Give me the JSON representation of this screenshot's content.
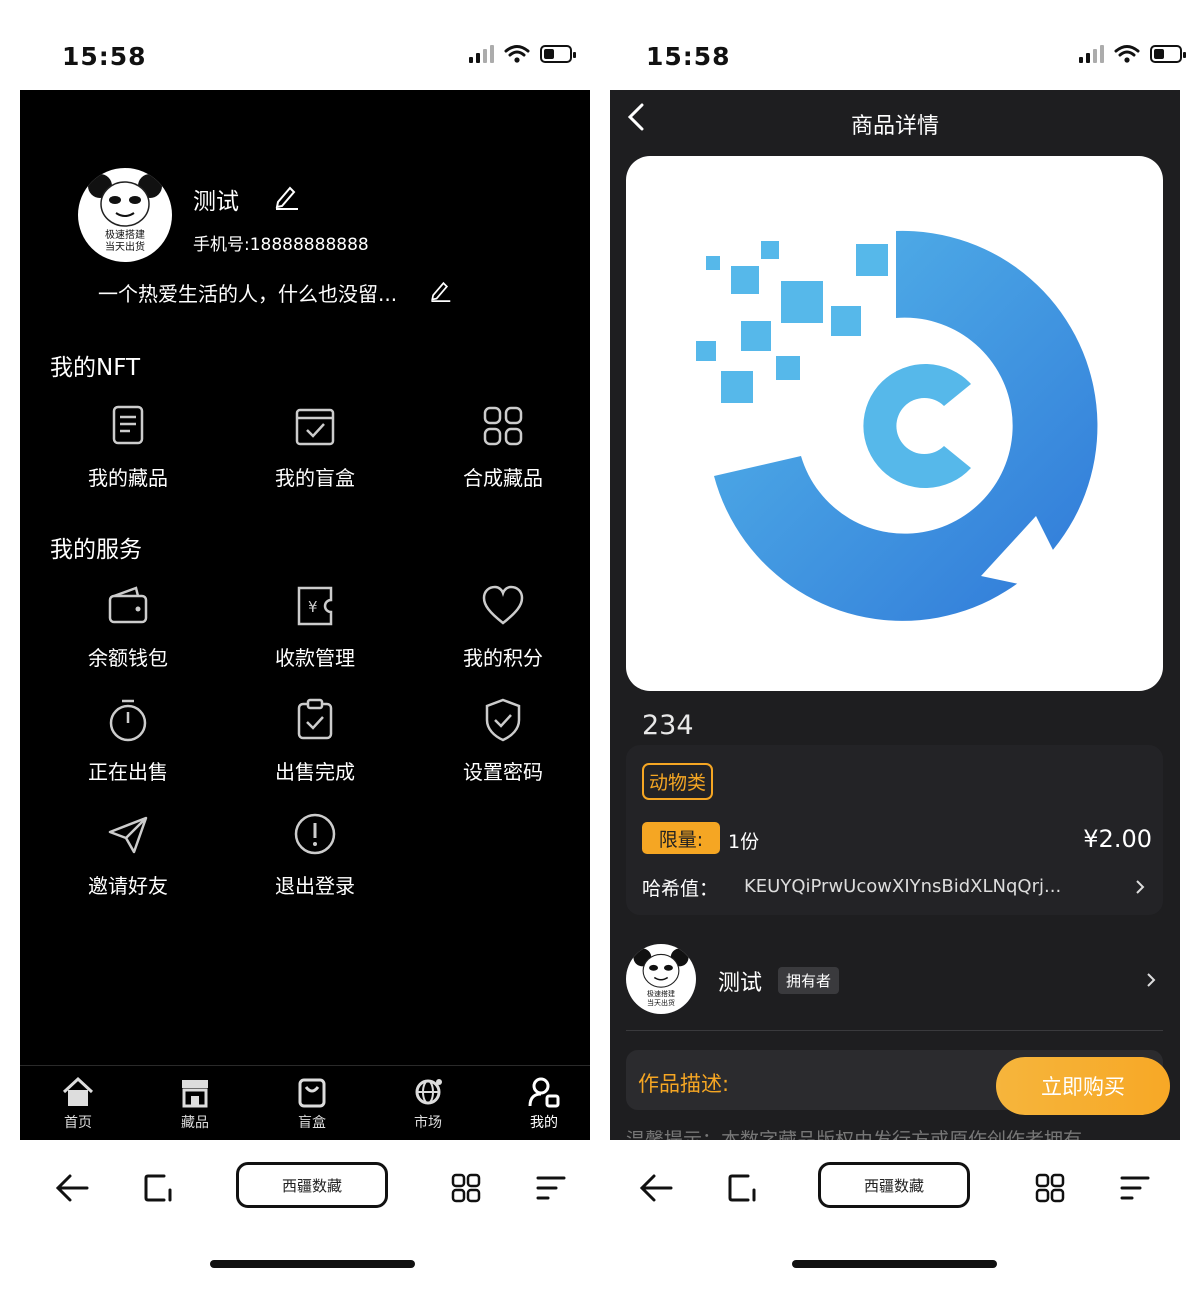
{
  "status": {
    "time": "15:58"
  },
  "browser": {
    "title": "西疆数藏"
  },
  "profile": {
    "avatar_text_1": "极速搭建",
    "avatar_text_2": "当天出货",
    "name": "测试",
    "phone": "手机号:18888888888",
    "bio": "一个热爱生活的人，什么也没留..."
  },
  "nft_section": {
    "title": "我的NFT",
    "items": [
      {
        "label": "我的藏品",
        "icon": "document-icon"
      },
      {
        "label": "我的盲盒",
        "icon": "checkbox-tray-icon"
      },
      {
        "label": "合成藏品",
        "icon": "grid-icon"
      }
    ]
  },
  "service_section": {
    "title": "我的服务",
    "items": [
      {
        "label": "余额钱包",
        "icon": "wallet-icon"
      },
      {
        "label": "收款管理",
        "icon": "yen-card-icon"
      },
      {
        "label": "我的积分",
        "icon": "heart-icon"
      },
      {
        "label": "正在出售",
        "icon": "stopwatch-icon"
      },
      {
        "label": "出售完成",
        "icon": "clipboard-check-icon"
      },
      {
        "label": "设置密码",
        "icon": "shield-check-icon"
      },
      {
        "label": "邀请好友",
        "icon": "send-icon"
      },
      {
        "label": "退出登录",
        "icon": "exclamation-icon"
      }
    ]
  },
  "tabbar": [
    {
      "label": "首页",
      "icon": "home-icon"
    },
    {
      "label": "藏品",
      "icon": "store-icon"
    },
    {
      "label": "盲盒",
      "icon": "bag-icon"
    },
    {
      "label": "市场",
      "icon": "market-icon"
    },
    {
      "label": "我的",
      "icon": "user-icon"
    }
  ],
  "detail": {
    "nav_title": "商品详情",
    "product_name": "234",
    "category": "动物类",
    "limit_label": "限量:",
    "limit_value": "1份",
    "price": "¥2.00",
    "hash_label": "哈希值：",
    "hash_value": "KEUYQiPrwUcowXIYnsBidXLNqQrj...",
    "owner_avatar_text_1": "极速搭建",
    "owner_avatar_text_2": "当天出货",
    "owner_name": "测试",
    "owner_role": "拥有者",
    "desc_label": "作品描述:",
    "buy_label": "立即购买",
    "desc_text": "温馨提示：本数字藏品版权由发行方或原作创作者拥有"
  },
  "colors": {
    "accent": "#f5a623",
    "logo_blue": "#2f8ae0",
    "logo_light": "#56b8ea"
  }
}
